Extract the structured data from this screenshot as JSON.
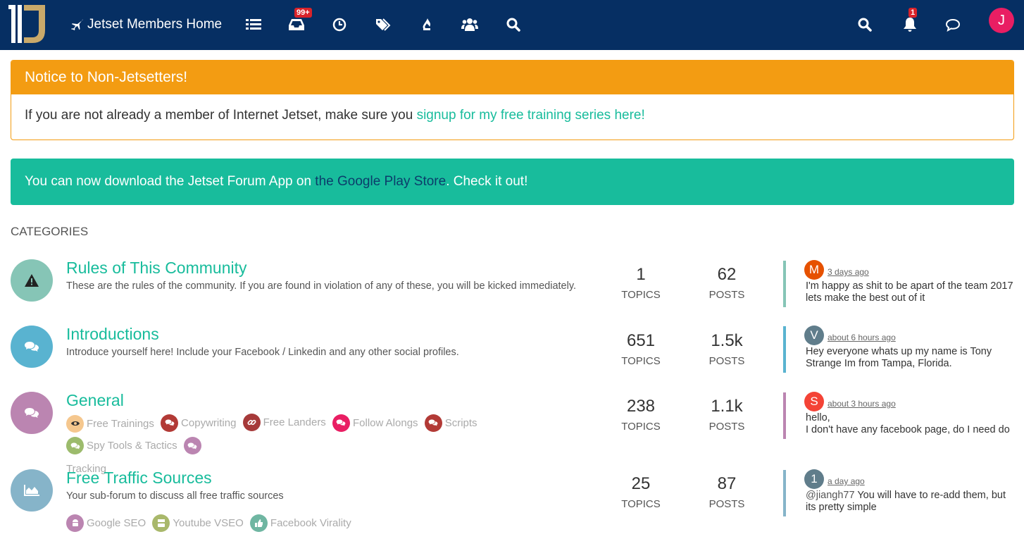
{
  "header": {
    "title": "Jetset Members Home",
    "unread_badge": "99+",
    "notifications_badge": "1",
    "user_initial": "J",
    "brand_color": "#062f63"
  },
  "notice": {
    "title": "Notice to Non-Jetsetters!",
    "text": "If you are not already a member of Internet Jetset, make sure you ",
    "link": "signup for my free training series here!"
  },
  "promo": {
    "before": "You can now download the Jetset Forum App on ",
    "link": "the Google Play Store",
    "after": ". Check it out!"
  },
  "categories_heading": "CATEGORIES",
  "categories": [
    {
      "name": "Rules of This Community",
      "description": "These are the rules of the community. If you are found in violation of any of these, you will be kicked immediately.",
      "icon": "warning-icon",
      "color": "#86c5b6",
      "topics": "1",
      "topics_label": "TOPICS",
      "posts": "62",
      "posts_label": "POSTS",
      "teaser": {
        "initial": "M",
        "avatar_color": "#e65100",
        "time": "3 days ago",
        "text": "I'm happy as shit to be apart of the team 2017 lets make the best out of it"
      }
    },
    {
      "name": "Introductions",
      "description": "Introduce yourself here! Include your Facebook / Linkedin and any other social profiles.",
      "icon": "comments-icon",
      "color": "#59b3d0",
      "topics": "651",
      "topics_label": "TOPICS",
      "posts": "1.5k",
      "posts_label": "POSTS",
      "teaser": {
        "initial": "V",
        "avatar_color": "#607d8b",
        "time": "about 6 hours ago",
        "text": "Hey everyone whats up my name is Tony Strange Im from Tampa, Florida."
      }
    },
    {
      "name": "General",
      "icon": "comments-icon",
      "color": "#bb85b1",
      "topics": "238",
      "topics_label": "TOPICS",
      "posts": "1.1k",
      "posts_label": "POSTS",
      "subcategories": [
        {
          "name": "Free Trainings",
          "color": "#f5c78e",
          "icon": "eye-icon"
        },
        {
          "name": "Copywriting",
          "color": "#b23a36",
          "icon": "comments-icon"
        },
        {
          "name": "Free Landers",
          "color": "#a63a3a",
          "icon": "link-icon"
        },
        {
          "name": "Follow Alongs",
          "color": "#e91e63",
          "icon": "comments-icon"
        },
        {
          "name": "Scripts",
          "color": "#b23a36",
          "icon": "comments-icon"
        },
        {
          "name": "Spy Tools & Tactics",
          "color": "#9cbb6c",
          "icon": "comments-icon"
        },
        {
          "name": "Tracking",
          "color": "#bb85b1",
          "icon": "comments-icon"
        }
      ],
      "teaser": {
        "initial": "S",
        "avatar_color": "#f44336",
        "time": "about 3 hours ago",
        "text_line1": "hello,",
        "text_line2": "I don't have any facebook page, do I need do"
      }
    },
    {
      "name": "Free Traffic Sources",
      "description": "Your sub-forum to discuss all free traffic sources",
      "icon": "area-chart-icon",
      "color": "#86b4c9",
      "topics": "25",
      "topics_label": "TOPICS",
      "posts": "87",
      "posts_label": "POSTS",
      "subcategories": [
        {
          "name": "Google SEO",
          "color": "#bb85b1",
          "icon": "android-icon"
        },
        {
          "name": "Youtube VSEO",
          "color": "#a9b86b",
          "icon": "youtube-icon"
        },
        {
          "name": "Facebook Virality",
          "color": "#6fb6a2",
          "icon": "thumbs-up-icon"
        }
      ],
      "teaser": {
        "initial": "1",
        "avatar_color": "#607d8b",
        "time": "a day ago",
        "mention": "@jiangh77",
        "text": " You will have to re-add them, but its pretty simple"
      }
    }
  ]
}
